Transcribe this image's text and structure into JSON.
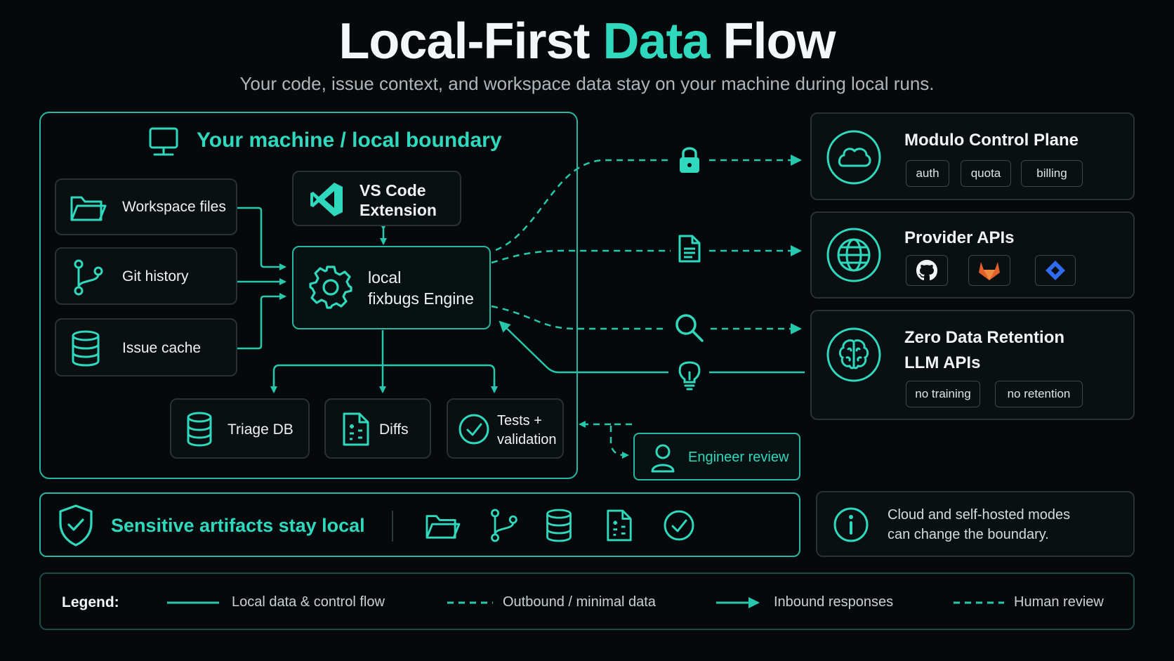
{
  "title": {
    "part1": "Local-First ",
    "accent": "Data",
    "part2": " Flow"
  },
  "subtitle": "Your code, issue context, and workspace data stay on your machine during local runs.",
  "colors": {
    "accent": "#2fd9bd",
    "border": "#26b9a2",
    "background": "#05090c",
    "gitlab": "#e2612b",
    "jira": "#2f6cf0"
  },
  "local_boundary": {
    "title": "Your machine / local boundary",
    "sources": [
      {
        "label": "Workspace files",
        "icon": "folder-icon"
      },
      {
        "label": "Git history",
        "icon": "git-branch-icon"
      },
      {
        "label": "Issue cache",
        "icon": "database-icon"
      }
    ],
    "vscode": {
      "line1": "VS Code",
      "line2": "Extension",
      "icon": "vscode-icon"
    },
    "engine": {
      "line1": "local",
      "line2": "fixbugs Engine",
      "icon": "gear-icon"
    },
    "outputs": [
      {
        "label": "Triage DB",
        "icon": "database-icon"
      },
      {
        "label": "Diffs",
        "icon": "diff-file-icon"
      },
      {
        "line1": "Tests +",
        "line2": "validation",
        "icon": "check-circle-icon"
      }
    ]
  },
  "flow_icons": [
    "lock-icon",
    "document-icon",
    "search-icon",
    "lightbulb-icon"
  ],
  "services": {
    "control_plane": {
      "title": "Modulo Control Plane",
      "chips": [
        "auth",
        "quota",
        "billing"
      ],
      "icon": "cloud-icon"
    },
    "provider_apis": {
      "title": "Provider APIs",
      "icon": "globe-icon",
      "providers": [
        "github-icon",
        "gitlab-icon",
        "jira-icon"
      ]
    },
    "zdr": {
      "line1": "Zero Data Retention",
      "line2": "LLM APIs",
      "chips": [
        "no training",
        "no retention"
      ],
      "icon": "brain-icon"
    }
  },
  "engineer_review": "Engineer review",
  "sensitive": {
    "label": "Sensitive artifacts stay local"
  },
  "info": {
    "line1": "Cloud and self-hosted modes",
    "line2": "can change the boundary."
  },
  "legend": {
    "title": "Legend:",
    "items": [
      "Local data & control flow",
      "Outbound / minimal data",
      "Inbound responses",
      "Human review"
    ]
  }
}
